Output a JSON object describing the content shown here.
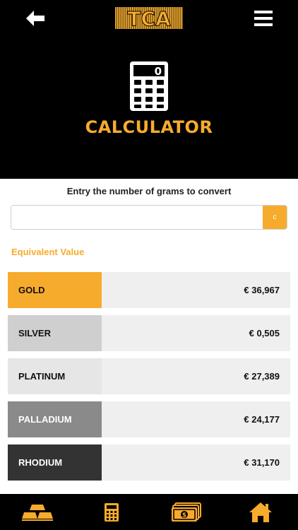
{
  "header": {
    "logo_text": "TCA",
    "title": "CALCULATOR",
    "icons": {
      "back": "arrow-left-icon",
      "menu": "hamburger-menu-icon",
      "hero": "calculator-icon",
      "hero_display": "0"
    }
  },
  "converter": {
    "instruction": "Entry the number of grams to convert",
    "input_value": "",
    "clear_label": "c"
  },
  "results": {
    "label": "Equivalent Value",
    "rows": [
      {
        "name": "GOLD",
        "value": "€ 36,967",
        "color": "#f7ab2d",
        "text_color": "#111111"
      },
      {
        "name": "SILVER",
        "value": "€ 0,505",
        "color": "#cfcfcf",
        "text_color": "#111111"
      },
      {
        "name": "PLATINUM",
        "value": "€ 27,389",
        "color": "#e6e6e6",
        "text_color": "#111111"
      },
      {
        "name": "PALLADIUM",
        "value": "€ 24,177",
        "color": "#8a8a8a",
        "text_color": "#ffffff"
      },
      {
        "name": "RHODIUM",
        "value": "€ 31,170",
        "color": "#333333",
        "text_color": "#ffffff"
      }
    ]
  },
  "bottom_nav": {
    "items": [
      "gold-bars-icon",
      "calculator-icon",
      "banknotes-icon",
      "home-icon"
    ]
  },
  "colors": {
    "accent": "#f7ab2d",
    "header_bg": "#000000",
    "row_value_bg": "#efefef"
  }
}
